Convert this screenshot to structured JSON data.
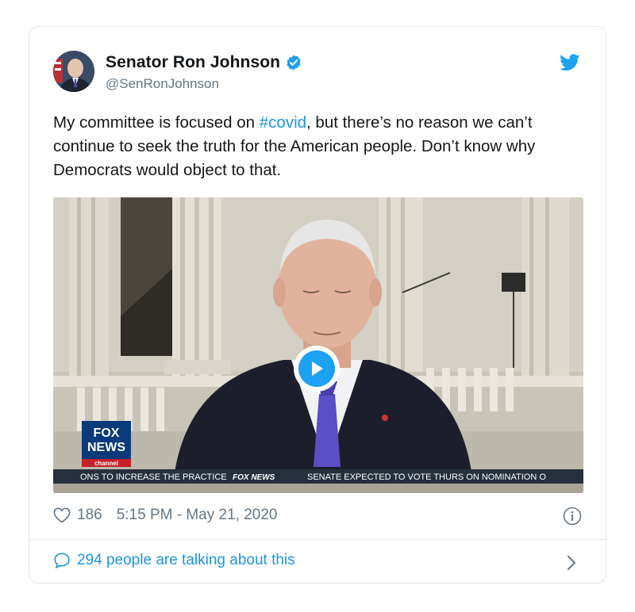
{
  "author": {
    "display_name": "Senator Ron Johnson",
    "handle": "@SenRonJohnson",
    "verified": true
  },
  "tweet": {
    "text_before": "My committee is focused on ",
    "hashtag": "#covid",
    "text_after": ", but there’s no reason we can’t continue to seek the truth for the American people. Don’t know why Democrats would object to that."
  },
  "media": {
    "logo_line1": "FOX",
    "logo_line2": "NEWS",
    "logo_line3": "channel",
    "ticker_left": "ONS TO INCREASE THE PRACTICE",
    "ticker_brand": "FOX NEWS",
    "ticker_right": "SENATE EXPECTED TO VOTE THURS ON NOMINATION O"
  },
  "stats": {
    "likes": "186",
    "timestamp": "5:15 PM - May 21, 2020"
  },
  "conversation": {
    "label": "294 people are talking about this"
  },
  "colors": {
    "accent": "#1b95e0",
    "text": "#14171a",
    "muted": "#657786",
    "border": "#e1e8ed"
  }
}
